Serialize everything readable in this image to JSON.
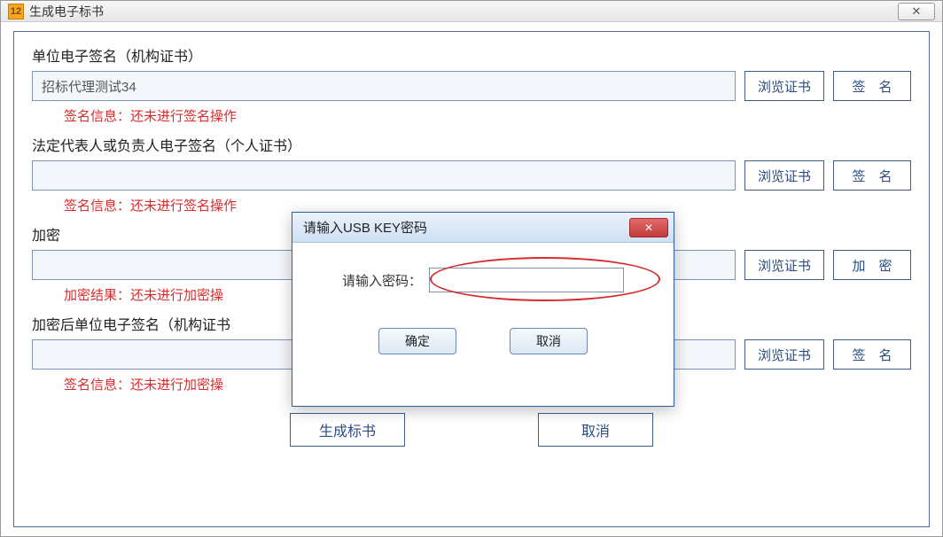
{
  "window": {
    "title": "生成电子标书",
    "close_symbol": "✕"
  },
  "sections": {
    "org_sign": {
      "label": "单位电子签名（机构证书）",
      "value": "招标代理测试34",
      "browse": "浏览证书",
      "sign": "签　名",
      "status": "签名信息：还未进行签名操作"
    },
    "person_sign": {
      "label": "法定代表人或负责人电子签名（个人证书）",
      "value": "",
      "browse": "浏览证书",
      "sign": "签　名",
      "status": "签名信息：还未进行签名操作"
    },
    "encrypt": {
      "label": "加密",
      "value": "",
      "browse": "浏览证书",
      "encrypt_btn": "加　密",
      "status": "加密结果：还未进行加密操"
    },
    "post_encrypt_sign": {
      "label": "加密后单位电子签名（机构证书",
      "value": "",
      "browse": "浏览证书",
      "sign": "签　名",
      "status": "签名信息：还未进行加密操"
    }
  },
  "bottom": {
    "generate": "生成标书",
    "cancel": "取消"
  },
  "dialog": {
    "title": "请输入USB KEY密码",
    "label": "请输入密码：",
    "ok": "确定",
    "cancel": "取消",
    "close_symbol": "✕"
  }
}
